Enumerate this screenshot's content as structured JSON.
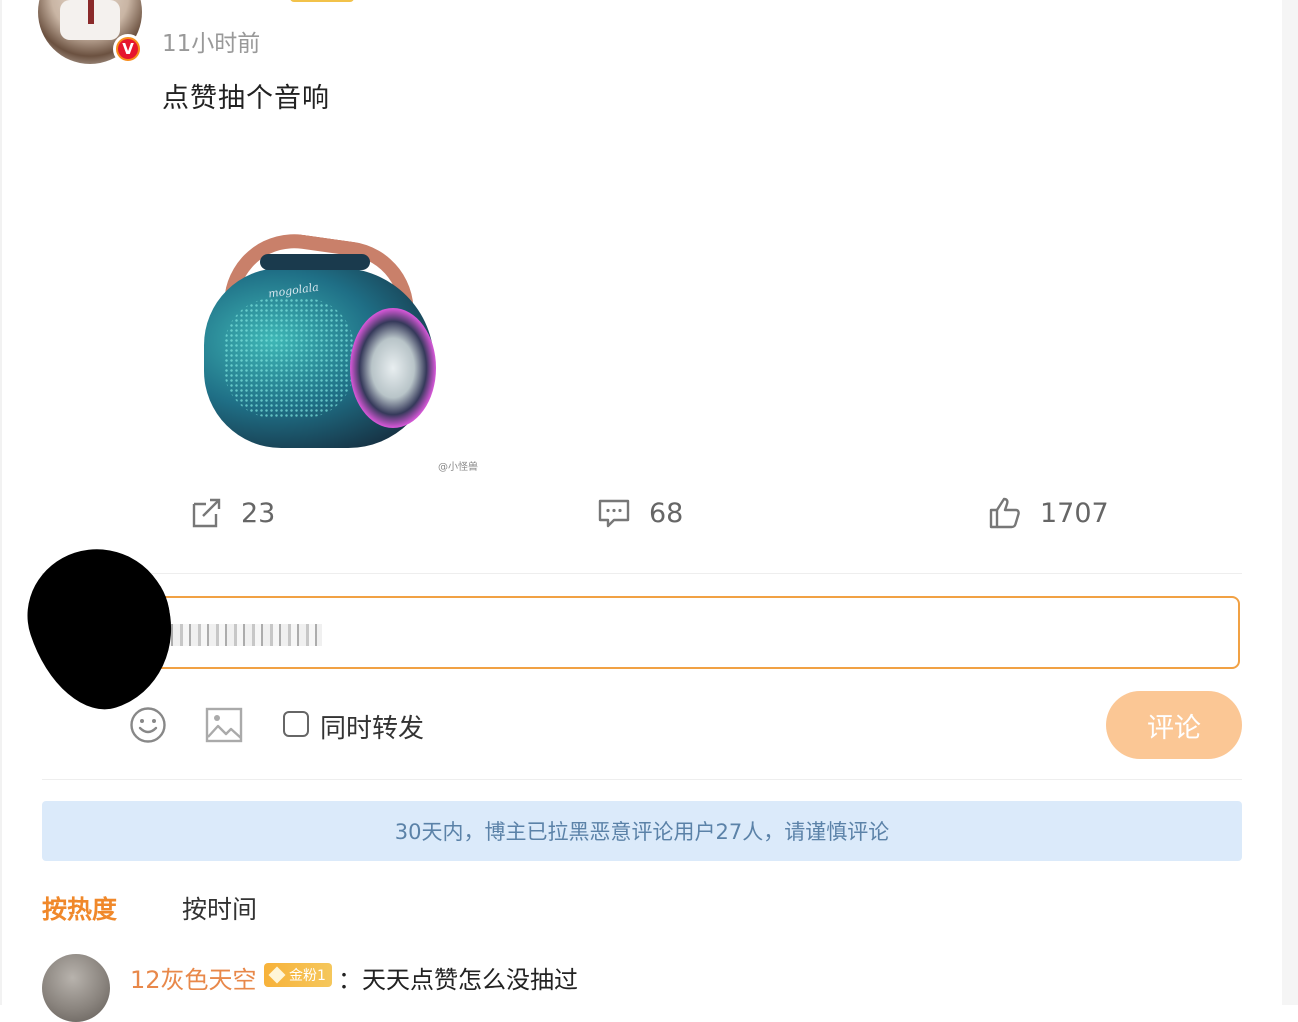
{
  "post": {
    "timestamp": "11小时前",
    "text": "点赞抽个音响",
    "image": {
      "brand_text": "mogolala",
      "watermark": "@小怪兽"
    }
  },
  "actions": {
    "repost_count": "23",
    "comment_count": "68",
    "like_count": "1707"
  },
  "composer": {
    "repost_toggle_label": "同时转发",
    "submit_label": "评论"
  },
  "notice": {
    "text": "30天内，博主已拉黑恶意评论用户27人，请谨慎评论"
  },
  "sort": {
    "hot_label": "按热度",
    "time_label": "按时间"
  },
  "comments": [
    {
      "username": "12灰色天空",
      "badge": "金粉1",
      "text": "：天天点赞怎么没抽过"
    }
  ],
  "colors": {
    "accent": "#f0882a",
    "input_border": "#f1a144",
    "submit_disabled": "#fbc795",
    "notice_bg": "#dbeafa",
    "notice_text": "#5b82a8",
    "username_color": "#e8884a"
  },
  "icons": [
    "verified-v-icon",
    "repost-icon",
    "comment-icon",
    "like-icon",
    "emoji-icon",
    "image-icon",
    "gem-icon"
  ]
}
